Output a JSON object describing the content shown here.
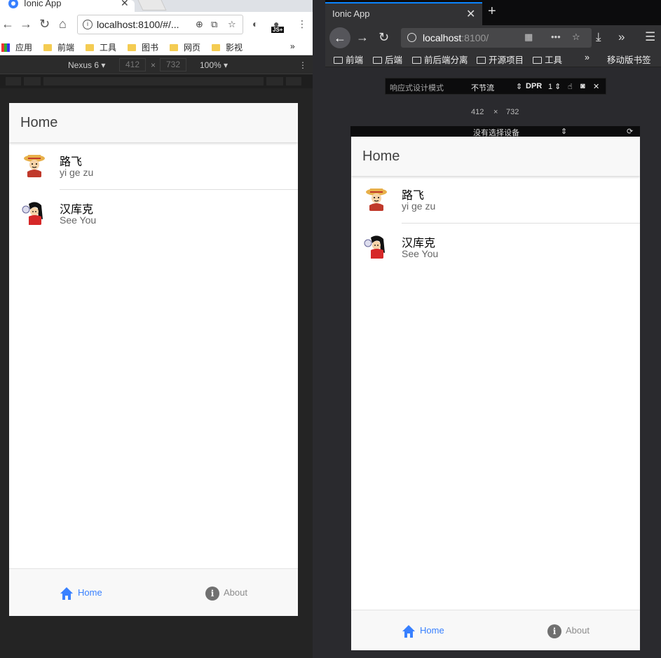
{
  "chrome": {
    "tab_title": "Ionic App",
    "tab_close": "✕",
    "url": "localhost:8100/#/...",
    "bookmarks": [
      "应用",
      "前端",
      "工具",
      "图书",
      "网页",
      "影视"
    ],
    "bookmarks_more": "»",
    "ext_badge": "JS+",
    "devtools": {
      "device": "Nexus 6",
      "width": "412",
      "height": "732",
      "times": "×",
      "zoom": "100%"
    }
  },
  "firefox": {
    "tab_title": "Ionic App",
    "tab_close": "✕",
    "new_tab": "+",
    "url_host": "localhost",
    "url_port": ":8100/",
    "page_actions": "•••",
    "bookmarks": [
      "前端",
      "后端",
      "前后端分离",
      "开源项目",
      "工具"
    ],
    "bookmarks_more": "»",
    "mobile_bookmarks": "移动版书签",
    "rdm": {
      "title": "响应式设计模式",
      "throttle": "不节流",
      "dpr_label": "DPR",
      "dpr_value": "1",
      "width": "412",
      "height": "732",
      "times": "×",
      "device": "没有选择设备"
    }
  },
  "app": {
    "header_title": "Home",
    "items": [
      {
        "name": "路飞",
        "subtitle": "yi ge zu",
        "avatar": "luffy-avatar"
      },
      {
        "name": "汉库克",
        "subtitle": "See You",
        "avatar": "hancock-avatar"
      }
    ],
    "tabs": [
      {
        "label": "Home",
        "icon": "home-icon",
        "active": true
      },
      {
        "label": "About",
        "icon": "info-icon",
        "active": false
      }
    ],
    "colors": {
      "active_tab": "#3880ff",
      "inactive_tab": "#8c8c8c",
      "header_bg": "#f8f8f8"
    }
  }
}
